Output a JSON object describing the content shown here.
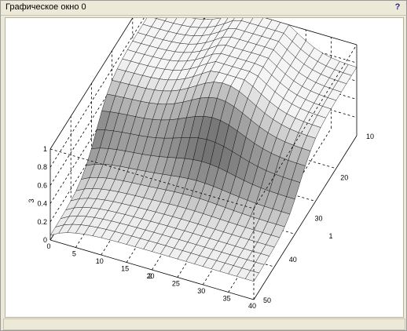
{
  "window": {
    "title": "Графическое окно 0",
    "help": "?"
  },
  "plot": {
    "z_axis_label": "3",
    "x_axis_label": "2",
    "y_axis_label": "1",
    "z_ticks": [
      "0",
      "0.2",
      "0.4",
      "0.6",
      "0.8",
      "1"
    ],
    "x_ticks": [
      "0",
      "5",
      "10",
      "15",
      "20",
      "25",
      "30",
      "35",
      "40"
    ],
    "y_ticks": [
      "10",
      "20",
      "30",
      "40",
      "50"
    ]
  },
  "colors": {
    "background": "#ece9d8",
    "canvas": "#ffffff"
  }
}
